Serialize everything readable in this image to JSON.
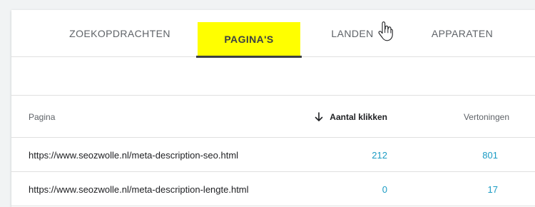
{
  "tabs": [
    {
      "label": "ZOEKOPDRACHTEN"
    },
    {
      "label": "PAGINA'S"
    },
    {
      "label": "LANDEN"
    },
    {
      "label": "APPARATEN"
    }
  ],
  "highlight_color": "#ffff00",
  "accent_color": "#1a9bc4",
  "table": {
    "headers": {
      "page": "Pagina",
      "clicks": "Aantal klikken",
      "views": "Vertoningen"
    },
    "sort_icon": "arrow-down-icon",
    "rows": [
      {
        "url": "https://www.seozwolle.nl/meta-description-seo.html",
        "clicks": "212",
        "views": "801"
      },
      {
        "url": "https://www.seozwolle.nl/meta-description-lengte.html",
        "clicks": "0",
        "views": "17"
      }
    ]
  }
}
